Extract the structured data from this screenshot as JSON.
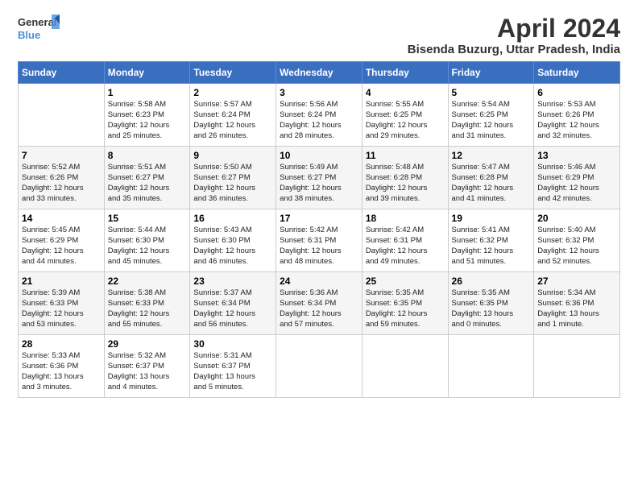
{
  "header": {
    "logo_line1": "General",
    "logo_line2": "Blue",
    "title": "April 2024",
    "subtitle": "Bisenda Buzurg, Uttar Pradesh, India"
  },
  "calendar": {
    "days_of_week": [
      "Sunday",
      "Monday",
      "Tuesday",
      "Wednesday",
      "Thursday",
      "Friday",
      "Saturday"
    ],
    "weeks": [
      [
        {
          "day": "",
          "content": ""
        },
        {
          "day": "1",
          "content": "Sunrise: 5:58 AM\nSunset: 6:23 PM\nDaylight: 12 hours\nand 25 minutes."
        },
        {
          "day": "2",
          "content": "Sunrise: 5:57 AM\nSunset: 6:24 PM\nDaylight: 12 hours\nand 26 minutes."
        },
        {
          "day": "3",
          "content": "Sunrise: 5:56 AM\nSunset: 6:24 PM\nDaylight: 12 hours\nand 28 minutes."
        },
        {
          "day": "4",
          "content": "Sunrise: 5:55 AM\nSunset: 6:25 PM\nDaylight: 12 hours\nand 29 minutes."
        },
        {
          "day": "5",
          "content": "Sunrise: 5:54 AM\nSunset: 6:25 PM\nDaylight: 12 hours\nand 31 minutes."
        },
        {
          "day": "6",
          "content": "Sunrise: 5:53 AM\nSunset: 6:26 PM\nDaylight: 12 hours\nand 32 minutes."
        }
      ],
      [
        {
          "day": "7",
          "content": "Sunrise: 5:52 AM\nSunset: 6:26 PM\nDaylight: 12 hours\nand 33 minutes."
        },
        {
          "day": "8",
          "content": "Sunrise: 5:51 AM\nSunset: 6:27 PM\nDaylight: 12 hours\nand 35 minutes."
        },
        {
          "day": "9",
          "content": "Sunrise: 5:50 AM\nSunset: 6:27 PM\nDaylight: 12 hours\nand 36 minutes."
        },
        {
          "day": "10",
          "content": "Sunrise: 5:49 AM\nSunset: 6:27 PM\nDaylight: 12 hours\nand 38 minutes."
        },
        {
          "day": "11",
          "content": "Sunrise: 5:48 AM\nSunset: 6:28 PM\nDaylight: 12 hours\nand 39 minutes."
        },
        {
          "day": "12",
          "content": "Sunrise: 5:47 AM\nSunset: 6:28 PM\nDaylight: 12 hours\nand 41 minutes."
        },
        {
          "day": "13",
          "content": "Sunrise: 5:46 AM\nSunset: 6:29 PM\nDaylight: 12 hours\nand 42 minutes."
        }
      ],
      [
        {
          "day": "14",
          "content": "Sunrise: 5:45 AM\nSunset: 6:29 PM\nDaylight: 12 hours\nand 44 minutes."
        },
        {
          "day": "15",
          "content": "Sunrise: 5:44 AM\nSunset: 6:30 PM\nDaylight: 12 hours\nand 45 minutes."
        },
        {
          "day": "16",
          "content": "Sunrise: 5:43 AM\nSunset: 6:30 PM\nDaylight: 12 hours\nand 46 minutes."
        },
        {
          "day": "17",
          "content": "Sunrise: 5:42 AM\nSunset: 6:31 PM\nDaylight: 12 hours\nand 48 minutes."
        },
        {
          "day": "18",
          "content": "Sunrise: 5:42 AM\nSunset: 6:31 PM\nDaylight: 12 hours\nand 49 minutes."
        },
        {
          "day": "19",
          "content": "Sunrise: 5:41 AM\nSunset: 6:32 PM\nDaylight: 12 hours\nand 51 minutes."
        },
        {
          "day": "20",
          "content": "Sunrise: 5:40 AM\nSunset: 6:32 PM\nDaylight: 12 hours\nand 52 minutes."
        }
      ],
      [
        {
          "day": "21",
          "content": "Sunrise: 5:39 AM\nSunset: 6:33 PM\nDaylight: 12 hours\nand 53 minutes."
        },
        {
          "day": "22",
          "content": "Sunrise: 5:38 AM\nSunset: 6:33 PM\nDaylight: 12 hours\nand 55 minutes."
        },
        {
          "day": "23",
          "content": "Sunrise: 5:37 AM\nSunset: 6:34 PM\nDaylight: 12 hours\nand 56 minutes."
        },
        {
          "day": "24",
          "content": "Sunrise: 5:36 AM\nSunset: 6:34 PM\nDaylight: 12 hours\nand 57 minutes."
        },
        {
          "day": "25",
          "content": "Sunrise: 5:35 AM\nSunset: 6:35 PM\nDaylight: 12 hours\nand 59 minutes."
        },
        {
          "day": "26",
          "content": "Sunrise: 5:35 AM\nSunset: 6:35 PM\nDaylight: 13 hours\nand 0 minutes."
        },
        {
          "day": "27",
          "content": "Sunrise: 5:34 AM\nSunset: 6:36 PM\nDaylight: 13 hours\nand 1 minute."
        }
      ],
      [
        {
          "day": "28",
          "content": "Sunrise: 5:33 AM\nSunset: 6:36 PM\nDaylight: 13 hours\nand 3 minutes."
        },
        {
          "day": "29",
          "content": "Sunrise: 5:32 AM\nSunset: 6:37 PM\nDaylight: 13 hours\nand 4 minutes."
        },
        {
          "day": "30",
          "content": "Sunrise: 5:31 AM\nSunset: 6:37 PM\nDaylight: 13 hours\nand 5 minutes."
        },
        {
          "day": "",
          "content": ""
        },
        {
          "day": "",
          "content": ""
        },
        {
          "day": "",
          "content": ""
        },
        {
          "day": "",
          "content": ""
        }
      ]
    ]
  }
}
